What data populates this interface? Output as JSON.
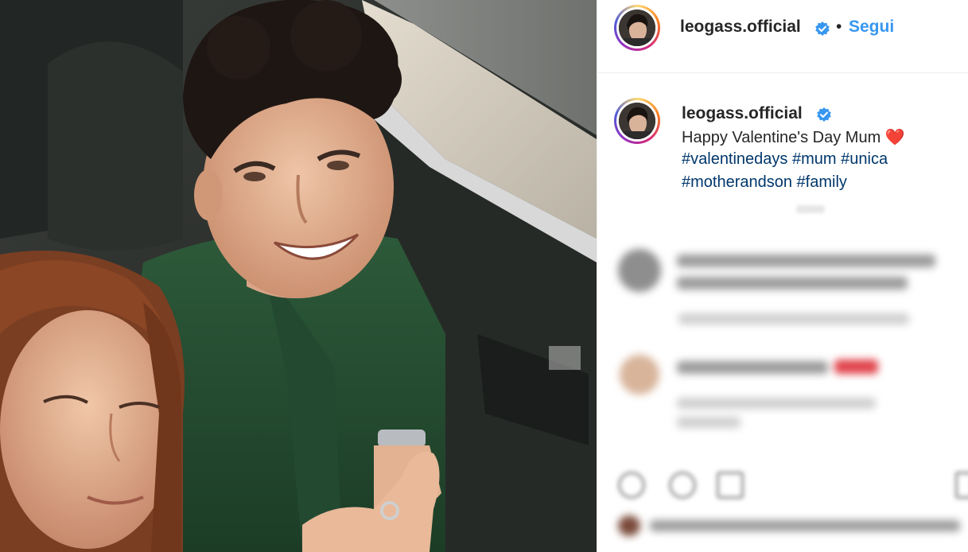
{
  "post": {
    "username": "leogass.official",
    "separator": "•",
    "follow_label": "Segui",
    "caption": {
      "line1": "Happy Valentine's Day Mum",
      "heart": "❤️",
      "hashtags_line1": [
        "#valentinedays",
        "#mum",
        "#unica"
      ],
      "hashtags_line2": [
        "#motherandson",
        "#family"
      ]
    }
  },
  "icons": {
    "verified": "verified-badge-icon",
    "like": "heart-icon",
    "comment": "comment-icon",
    "share": "share-icon",
    "save": "bookmark-icon"
  },
  "colors": {
    "link_blue": "#3897f0",
    "hashtag_blue": "#00376b",
    "verified_blue": "#3897f0",
    "text": "#262626",
    "divider": "#efefef"
  }
}
